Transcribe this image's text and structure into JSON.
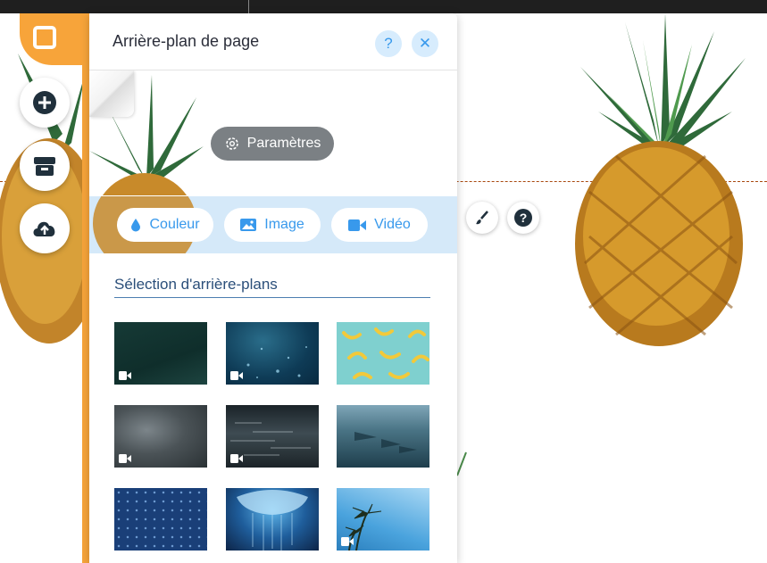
{
  "panel": {
    "title": "Arrière-plan de page",
    "help_label": "?",
    "close_label": "✕",
    "settings_label": "Paramètres"
  },
  "types": [
    {
      "label": "Couleur",
      "icon": "drop-icon"
    },
    {
      "label": "Image",
      "icon": "image-icon"
    },
    {
      "label": "Vidéo",
      "icon": "video-camera-icon"
    }
  ],
  "gallery": {
    "title": "Sélection d'arrière-plans",
    "items": [
      {
        "name": "dark-green-video",
        "kind": "video"
      },
      {
        "name": "underwater-bubbles-video",
        "kind": "video"
      },
      {
        "name": "bananas-pattern-image",
        "kind": "image"
      },
      {
        "name": "storm-clouds-video",
        "kind": "video"
      },
      {
        "name": "night-water-video",
        "kind": "video"
      },
      {
        "name": "underwater-rays-video",
        "kind": "video"
      },
      {
        "name": "blue-dots-pattern-image",
        "kind": "image"
      },
      {
        "name": "jellyfish-image",
        "kind": "image"
      },
      {
        "name": "palm-trees-video",
        "kind": "video"
      }
    ]
  },
  "side_tools": [
    "add-icon",
    "store-icon",
    "upload-cloud-icon"
  ],
  "colors": {
    "accent": "#3899ec",
    "orange": "#f7a43a",
    "band": "#d5e9f9"
  }
}
